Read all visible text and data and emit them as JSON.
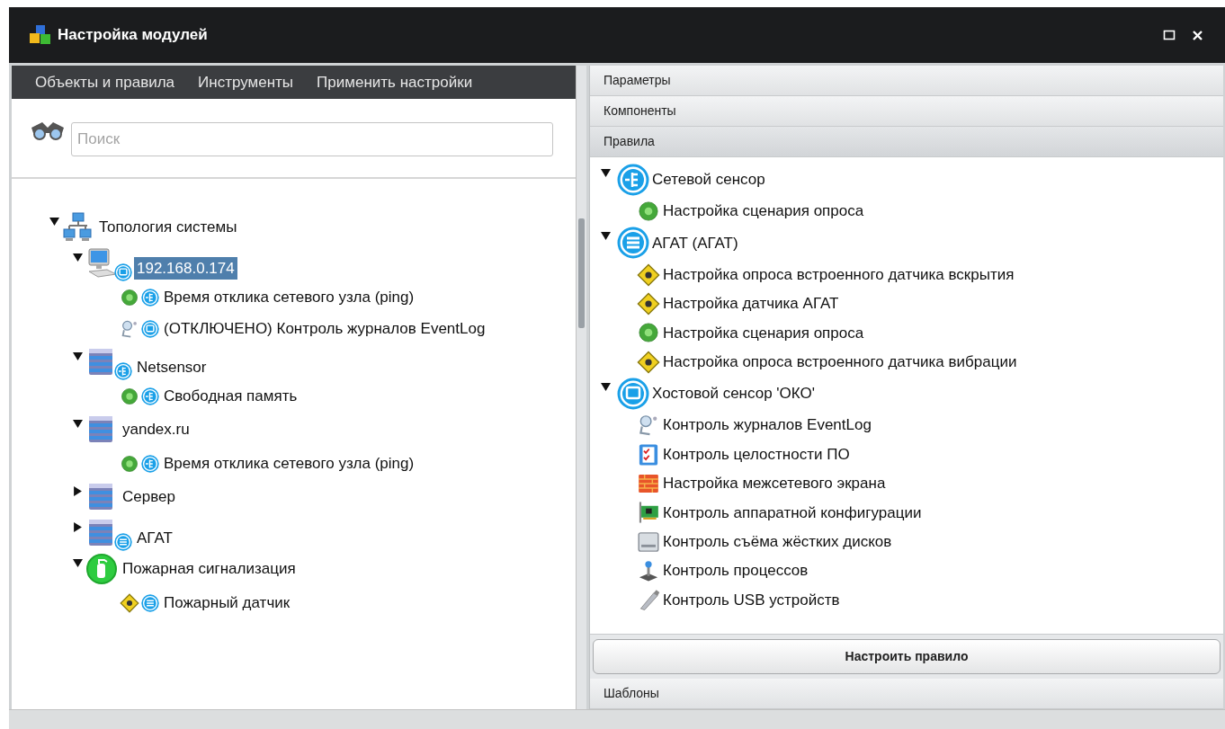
{
  "window": {
    "title": "Настройка модулей"
  },
  "menu": [
    "Объекты и правила",
    "Инструменты",
    "Применить настройки"
  ],
  "search": {
    "placeholder": "Поиск"
  },
  "object_tree": [
    {
      "label": "Топология системы",
      "kind": "topology",
      "expanded": true,
      "selected": false,
      "children": [
        {
          "label": "192.168.0.174",
          "kind": "computer",
          "badge": {
            "kind": "host"
          },
          "expanded": true,
          "selected": true,
          "children": [
            {
              "label": "Время отклика сетевого узла (ping)",
              "kind": "ok",
              "badge": {
                "kind": "net"
              },
              "selected": false
            },
            {
              "label": "(ОТКЛЮЧЕНО) Контроль журналов EventLog",
              "kind": "eventlog",
              "badge": {
                "kind": "host"
              },
              "selected": false
            }
          ]
        },
        {
          "label": "Netsensor",
          "kind": "server",
          "badge": {
            "kind": "net"
          },
          "expanded": true,
          "selected": false,
          "children": [
            {
              "label": "Свободная память",
              "kind": "ok",
              "badge": {
                "kind": "net"
              },
              "selected": false
            }
          ]
        },
        {
          "label": "yandex.ru",
          "kind": "server",
          "expanded": true,
          "selected": false,
          "children": [
            {
              "label": "Время отклика сетевого узла (ping)",
              "kind": "ok",
              "badge": {
                "kind": "net"
              },
              "selected": false
            }
          ]
        },
        {
          "label": "Сервер",
          "kind": "server",
          "expanded": false,
          "selected": false
        },
        {
          "label": "АГАТ",
          "kind": "server",
          "badge": {
            "kind": "agat"
          },
          "expanded": false,
          "selected": false
        },
        {
          "label": "Пожарная сигнализация",
          "kind": "fire",
          "expanded": true,
          "selected": false,
          "children": [
            {
              "label": "Пожарный датчик",
              "kind": "sensor",
              "badge": {
                "kind": "agat"
              },
              "selected": false
            }
          ]
        }
      ]
    }
  ],
  "sections": [
    {
      "title": "Параметры",
      "expanded": false
    },
    {
      "title": "Компоненты",
      "expanded": false
    },
    {
      "title": "Правила",
      "expanded": true,
      "button": "Настроить правило",
      "rules": [
        {
          "label": "Сетевой сенсор",
          "kind": "net",
          "expanded": true,
          "selected": false,
          "children": [
            {
              "label": "Настройка сценария опроса",
              "kind": "ok",
              "selected": false
            }
          ]
        },
        {
          "label": "АГАТ (АГАТ)",
          "kind": "agat",
          "expanded": true,
          "selected": false,
          "children": [
            {
              "label": "Настройка опроса встроенного датчика вскрытия",
              "kind": "sensor",
              "selected": false
            },
            {
              "label": "Настройка датчика АГАТ",
              "kind": "sensor",
              "selected": false
            },
            {
              "label": "Настройка сценария опроса",
              "kind": "ok",
              "selected": false
            },
            {
              "label": "Настройка опроса встроенного датчика вибрации",
              "kind": "sensor",
              "selected": false
            }
          ]
        },
        {
          "label": "Хостовой сенсор 'ОКО'",
          "kind": "host",
          "expanded": true,
          "selected": false,
          "children": [
            {
              "label": "Контроль журналов EventLog",
              "kind": "eventlog",
              "selected": false
            },
            {
              "label": "Контроль целостности ПО",
              "kind": "integrity",
              "selected": false
            },
            {
              "label": "Настройка межсетевого экрана",
              "kind": "firewall",
              "selected": false
            },
            {
              "label": "Контроль аппаратной конфигурации",
              "kind": "hardware",
              "selected": false
            },
            {
              "label": "Контроль съёма жёстких дисков",
              "kind": "disk",
              "selected": false
            },
            {
              "label": "Контроль процессов",
              "kind": "process",
              "selected": false
            },
            {
              "label": "Контроль USB устройств",
              "kind": "usb",
              "selected": false
            }
          ]
        }
      ]
    },
    {
      "title": "Шаблоны",
      "expanded": false
    }
  ]
}
